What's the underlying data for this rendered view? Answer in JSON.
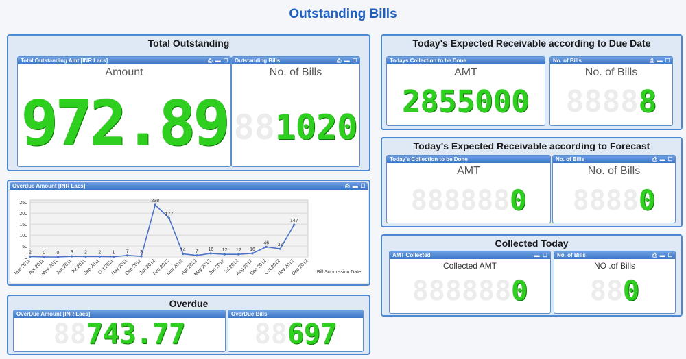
{
  "page_title": "Outstanding Bills",
  "colors": {
    "accent": "#4e88d0",
    "digit_on": "#2ecf1f",
    "digit_off": "#ececec",
    "line": "#4a72c9"
  },
  "total_outstanding": {
    "title": "Total Outstanding",
    "amount_box": {
      "caption": "Total Outstanding Amt [INR Lacs]",
      "label": "Amount",
      "ghost": "88888",
      "value": "972.89"
    },
    "bills_box": {
      "caption": "Outstanding Bills",
      "label": "No. of Bills",
      "ghost": "88",
      "value": "1020"
    }
  },
  "due_date": {
    "title": "Today's Expected Receivable according to Due Date",
    "amt_box": {
      "caption": "Todays Collection to be Done",
      "label": "AMT",
      "value": "2855000"
    },
    "bills_box": {
      "caption": "No. of Bills",
      "label": "No. of Bills",
      "ghost": "8888",
      "value": "8"
    }
  },
  "forecast": {
    "title": "Today's Expected Receivable according to Forecast",
    "amt_box": {
      "caption": "Today's Collection to be Done",
      "label": "AMT",
      "ghost": "888888",
      "value": "0"
    },
    "bills_box": {
      "caption": "No. of Bills",
      "label": "No. of Bills",
      "ghost": "8888",
      "value": "0"
    }
  },
  "collected": {
    "title": "Collected Today",
    "amt_box": {
      "caption": "AMT Collected",
      "label": "Collected AMT",
      "ghost": "888888",
      "value": "0"
    },
    "bills_box": {
      "caption": "No. of Bills",
      "label": "NO .of Bills",
      "ghost": "88",
      "value": "0"
    }
  },
  "overdue": {
    "title": "Overdue",
    "amt_box": {
      "caption": "OverDue Amount [INR Lacs]",
      "ghost": "88",
      "value": "743.77"
    },
    "bills_box": {
      "caption": "OverDue Bills",
      "ghost": "88",
      "value": "697"
    }
  },
  "overdue_chart_caption": "Overdue Amount [INR Lacs]",
  "chart_data": {
    "type": "line",
    "title": "",
    "xlabel": "Bill Submission Date",
    "ylabel": "",
    "categories": [
      "Mar 2011",
      "Apr 2011",
      "May 2011",
      "Jun 2011",
      "Jul 2011",
      "Sep 2011",
      "Oct 2011",
      "Nov 2011",
      "Dec 2011",
      "Jan 2012",
      "Feb 2012",
      "Mar 2012",
      "Apr 2012",
      "May 2012",
      "Jun 2012",
      "Jul 2012",
      "Aug 2012",
      "Sep 2012",
      "Oct 2012",
      "Nov 2012",
      "Dec 2012"
    ],
    "values": [
      2,
      0,
      0,
      3,
      2,
      2,
      1,
      7,
      3,
      238,
      177,
      14,
      7,
      16,
      12,
      12,
      16,
      46,
      37,
      147
    ],
    "yticks": [
      0,
      50,
      100,
      150,
      200,
      250
    ],
    "ylim": [
      0,
      260
    ],
    "grid": true
  }
}
